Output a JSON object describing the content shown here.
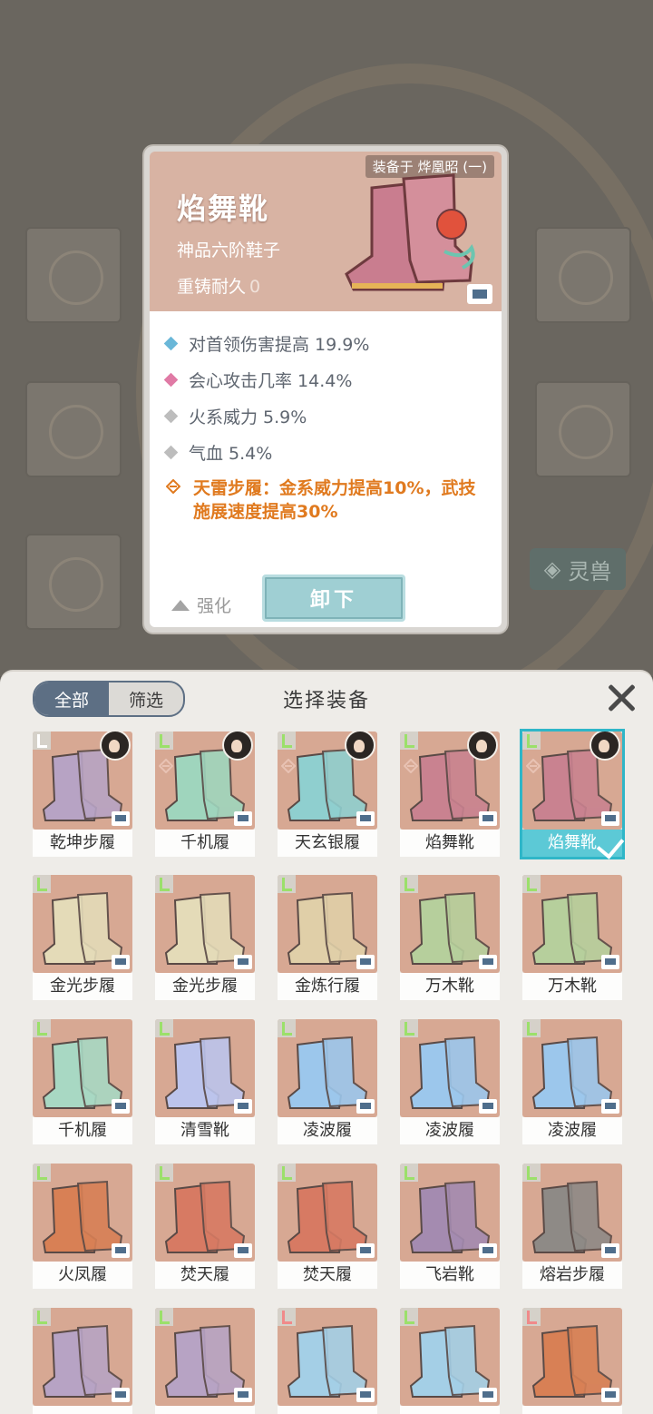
{
  "tooltip": {
    "equipped_label": "装备于 烨凰昭 (一)",
    "item_name": "焰舞靴",
    "item_type": "神品六阶鞋子",
    "durability_label": "重铸耐久",
    "durability_value": "0",
    "stats": [
      {
        "text": "对首领伤害提高 19.9%",
        "color": "#6ab7d8"
      },
      {
        "text": "会心攻击几率 14.4%",
        "color": "#e07aa5"
      },
      {
        "text": "火系威力 5.9%",
        "color": "#bdbdbd"
      },
      {
        "text": "气血 5.4%",
        "color": "#bdbdbd"
      }
    ],
    "special": "天雷步履：金系威力提高10%，武技施展速度提高30%",
    "strengthen_label": "强化",
    "unequip_label": "卸下"
  },
  "background": {
    "pet_button_label": "灵兽"
  },
  "panel": {
    "title": "选择装备",
    "tabs": [
      {
        "label": "全部",
        "active": true
      },
      {
        "label": "筛选",
        "active": false
      }
    ],
    "items": [
      {
        "name": "乾坤步履",
        "color": "#b7a3c4",
        "tag": "white",
        "avatar": true,
        "set": false,
        "selected": false
      },
      {
        "name": "千机履",
        "color": "#9fd5bd",
        "tag": "green",
        "avatar": true,
        "set": true,
        "selected": false
      },
      {
        "name": "天玄银履",
        "color": "#8fcfcf",
        "tag": "green",
        "avatar": true,
        "set": true,
        "selected": false
      },
      {
        "name": "焰舞靴",
        "color": "#c98290",
        "tag": "green",
        "avatar": true,
        "set": true,
        "selected": false
      },
      {
        "name": "焰舞靴",
        "color": "#c98290",
        "tag": "green",
        "avatar": true,
        "set": true,
        "selected": true
      },
      {
        "name": "金光步履",
        "color": "#e4dbb8",
        "tag": "green",
        "avatar": false,
        "set": false,
        "selected": false
      },
      {
        "name": "金光步履",
        "color": "#e4dbb8",
        "tag": "green",
        "avatar": false,
        "set": false,
        "selected": false
      },
      {
        "name": "金炼行履",
        "color": "#e0cfa8",
        "tag": "green",
        "avatar": false,
        "set": false,
        "selected": false
      },
      {
        "name": "万木靴",
        "color": "#b6cf9c",
        "tag": "green",
        "avatar": false,
        "set": false,
        "selected": false
      },
      {
        "name": "万木靴",
        "color": "#b6cf9c",
        "tag": "green",
        "avatar": false,
        "set": false,
        "selected": false
      },
      {
        "name": "千机履",
        "color": "#a8d8c3",
        "tag": "green",
        "avatar": false,
        "set": false,
        "selected": false
      },
      {
        "name": "清雪靴",
        "color": "#bcc4ec",
        "tag": "green",
        "avatar": false,
        "set": false,
        "selected": false
      },
      {
        "name": "凌波履",
        "color": "#9cc7ec",
        "tag": "green",
        "avatar": false,
        "set": false,
        "selected": false
      },
      {
        "name": "凌波履",
        "color": "#9cc7ec",
        "tag": "green",
        "avatar": false,
        "set": false,
        "selected": false
      },
      {
        "name": "凌波履",
        "color": "#9cc7ec",
        "tag": "green",
        "avatar": false,
        "set": false,
        "selected": false
      },
      {
        "name": "火凤履",
        "color": "#d88055",
        "tag": "green",
        "avatar": false,
        "set": false,
        "selected": false
      },
      {
        "name": "焚天履",
        "color": "#d77a63",
        "tag": "green",
        "avatar": false,
        "set": false,
        "selected": false
      },
      {
        "name": "焚天履",
        "color": "#d77a63",
        "tag": "green",
        "avatar": false,
        "set": false,
        "selected": false
      },
      {
        "name": "飞岩靴",
        "color": "#a48bb0",
        "tag": "green",
        "avatar": false,
        "set": false,
        "selected": false
      },
      {
        "name": "熔岩步履",
        "color": "#8e8a86",
        "tag": "green",
        "avatar": false,
        "set": false,
        "selected": false
      },
      {
        "name": "",
        "color": "#b7a3c4",
        "tag": "green",
        "avatar": false,
        "set": false,
        "selected": false
      },
      {
        "name": "",
        "color": "#b7a3c4",
        "tag": "green",
        "avatar": false,
        "set": false,
        "selected": false
      },
      {
        "name": "",
        "color": "#a4cfe6",
        "tag": "red",
        "avatar": false,
        "set": false,
        "selected": false
      },
      {
        "name": "",
        "color": "#a4cfe6",
        "tag": "green",
        "avatar": false,
        "set": false,
        "selected": false
      },
      {
        "name": "",
        "color": "#d88055",
        "tag": "red",
        "avatar": false,
        "set": false,
        "selected": false
      }
    ]
  }
}
